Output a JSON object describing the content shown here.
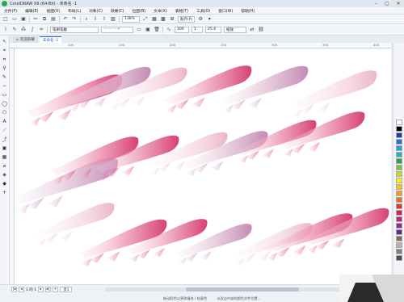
{
  "window": {
    "title": "CorelDRAW X8 (64-Bit) - 未命名 -1"
  },
  "menu": [
    "文件(F)",
    "编辑(E)",
    "视图(V)",
    "布局(L)",
    "对象(C)",
    "效果(C)",
    "位图(B)",
    "文本(X)",
    "表格(T)",
    "工具(O)",
    "窗口(W)",
    "帮助(H)"
  ],
  "toolbar1": {
    "zoom": "138%",
    "snap_label": "贴齐(P)"
  },
  "toolbar2": {
    "brush_preset": "笔刷笔触",
    "smoothing": "100",
    "size_value": "1",
    "width_value": "25.4",
    "mode": "缩放"
  },
  "tabs": [
    {
      "label": "欢迎屏幕",
      "active": false
    },
    {
      "label": "未命名 -1",
      "active": true
    }
  ],
  "ruler_top": [
    "100",
    "150",
    "200",
    "250",
    "300",
    "350",
    "400"
  ],
  "status": {
    "page_counter": "1 的 1",
    "page_tab": "页1",
    "text1": "拖动彩色以更改填充 / 轮廓色",
    "text2": "以双击中部的颜色文件位置..."
  },
  "palette": [
    "#ffffff",
    "#000000",
    "#1f3fa8",
    "#2a6fd6",
    "#19a8e0",
    "#1fb8a6",
    "#22a845",
    "#7cc242",
    "#c9d92b",
    "#fff200",
    "#f7c21a",
    "#f39a1e",
    "#ec6f1c",
    "#e63323",
    "#d41f4f",
    "#c81d7e",
    "#8a2b8e",
    "#5b2d8c",
    "#8a6b4e",
    "#b3b3b3",
    "#808080",
    "#4d4d4d"
  ]
}
